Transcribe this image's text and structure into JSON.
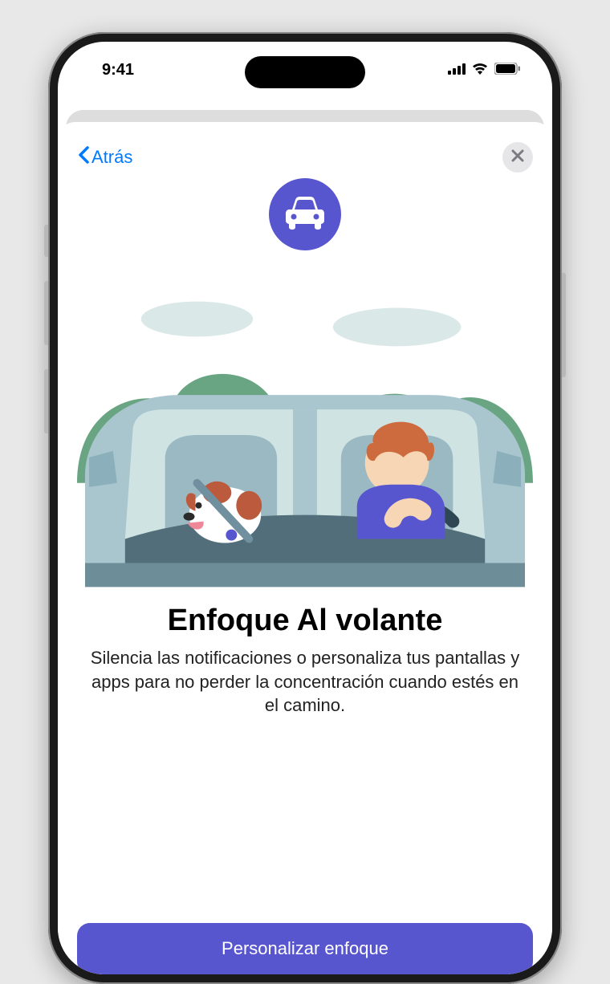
{
  "status": {
    "time": "9:41"
  },
  "nav": {
    "back_label": "Atrás"
  },
  "content": {
    "title": "Enfoque Al volante",
    "description": "Silencia las notificaciones o personaliza tus pantallas y apps para no perder la concentración cuando estés en el camino."
  },
  "actions": {
    "primary_label": "Personalizar enfoque"
  },
  "colors": {
    "accent": "#5856ce",
    "link": "#007aff"
  }
}
